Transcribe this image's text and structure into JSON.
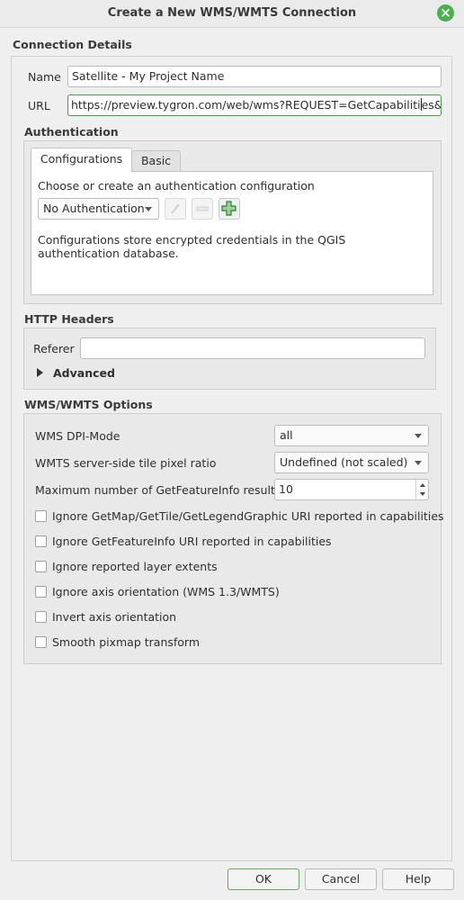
{
  "window": {
    "title": "Create a New WMS/WMTS Connection"
  },
  "connection_details": {
    "title": "Connection Details",
    "name_label": "Name",
    "name_value": "Satellite - My Project Name",
    "url_label": "URL",
    "url_value_before_caret": "https://preview.tygron.com/web/wms?REQUEST=GetCapabiliti",
    "url_value_after_caret": "es&token=",
    "accent_color": "#4a9b4a"
  },
  "authentication": {
    "title": "Authentication",
    "tabs": [
      {
        "label": "Configurations",
        "active": true
      },
      {
        "label": "Basic",
        "active": false
      }
    ],
    "prompt": "Choose or create an authentication configuration",
    "combo_value": "No Authentication",
    "description": "Configurations store encrypted credentials in the QGIS authentication database.",
    "tool_icons": [
      "pencil-icon",
      "minus-icon",
      "plus-icon"
    ]
  },
  "http_headers": {
    "title": "HTTP Headers",
    "referer_label": "Referer",
    "referer_value": "",
    "advanced_label": "Advanced"
  },
  "wms_options": {
    "title": "WMS/WMTS Options",
    "dpi_mode_label": "WMS DPI-Mode",
    "dpi_mode_value": "all",
    "tile_ratio_label": "WMTS server-side tile pixel ratio",
    "tile_ratio_value": "Undefined (not scaled)",
    "max_results_label": "Maximum number of GetFeatureInfo results",
    "max_results_value": "10",
    "checkboxes": [
      {
        "label": "Ignore GetMap/GetTile/GetLegendGraphic URI reported in capabilities",
        "checked": false
      },
      {
        "label": "Ignore GetFeatureInfo URI reported in capabilities",
        "checked": false
      },
      {
        "label": "Ignore reported layer extents",
        "checked": false
      },
      {
        "label": "Ignore axis orientation (WMS 1.3/WMTS)",
        "checked": false
      },
      {
        "label": "Invert axis orientation",
        "checked": false
      },
      {
        "label": "Smooth pixmap transform",
        "checked": false
      }
    ]
  },
  "buttons": {
    "ok": "OK",
    "cancel": "Cancel",
    "help": "Help"
  }
}
